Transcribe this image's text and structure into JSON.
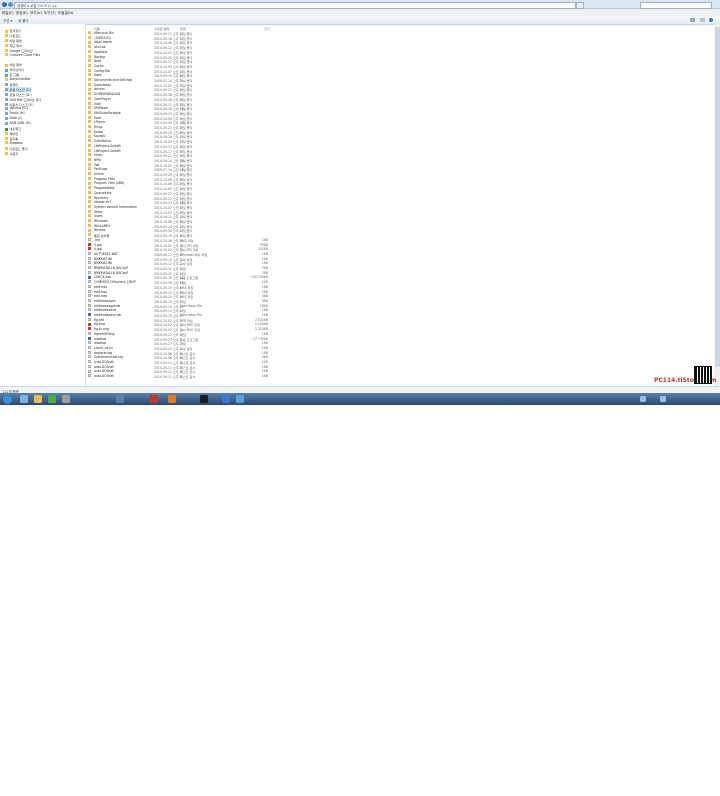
{
  "address": "컴퓨터 ▸ 로컬 디스크 (C:) ▸",
  "menu": [
    "파일(F)",
    "편집(E)",
    "보기(V)",
    "도구(T)",
    "도움말(H)"
  ],
  "toolbar": {
    "organize": "구성 ▾",
    "new_folder": "새 폴더"
  },
  "columns": {
    "name": "이름",
    "date": "수정한 날짜",
    "type": "유형",
    "size": "크기"
  },
  "nav": [
    {
      "label": "즐겨찾기",
      "icon": "star-icon"
    },
    {
      "label": "다운로드",
      "icon": "folder-icon"
    },
    {
      "label": "바탕 화면",
      "icon": "folder-icon"
    },
    {
      "label": "최근 위치",
      "icon": "folder-icon"
    },
    {
      "label": "Google 드라이브",
      "icon": "folder-icon"
    },
    {
      "label": "Creative Cloud Files",
      "icon": "folder-icon"
    },
    {
      "label": "",
      "icon": ""
    },
    {
      "label": "바탕 화면",
      "icon": "folder-icon"
    },
    {
      "label": "라이브러리",
      "icon": "library-icon"
    },
    {
      "label": "홈 그룹",
      "icon": "library-icon"
    },
    {
      "label": "Administrator",
      "icon": "folder-icon"
    },
    {
      "label": "컴퓨터",
      "icon": "drive-icon"
    },
    {
      "label": "로컬 디스크 (C:)",
      "icon": "drive-icon",
      "selected": true
    },
    {
      "label": "로컬 디스크 (D:)",
      "icon": "drive-icon"
    },
    {
      "label": "DVD RW 드라이브 (E:)",
      "icon": "drive-icon"
    },
    {
      "label": "이동식 디스크 (F:)",
      "icon": "drive-icon"
    },
    {
      "label": "Volume (G:)",
      "icon": "drive-icon"
    },
    {
      "label": "Public (H:)",
      "icon": "drive-icon"
    },
    {
      "label": "Data (I:)",
      "icon": "drive-icon"
    },
    {
      "label": "RAM DISK (R:)",
      "icon": "drive-icon"
    },
    {
      "label": "네트워크",
      "icon": "network-icon"
    },
    {
      "label": "제어판",
      "icon": "folder-icon"
    },
    {
      "label": "휴지통",
      "icon": "folder-icon"
    },
    {
      "label": "Dropbox",
      "icon": "folder-icon"
    },
    {
      "label": "다운로드 폴더",
      "icon": "folder-icon"
    },
    {
      "label": "사용자",
      "icon": "folder-icon"
    }
  ],
  "files": [
    {
      "name": "$Recycle.Bin",
      "date": "2014-09-11 오후 1:",
      "type": "파일 폴더",
      "size": "",
      "icon": "folder"
    },
    {
      "name": "_SMSDOCS",
      "date": "2014-09-16 오후 1:",
      "type": "파일 폴더",
      "size": "",
      "icon": "folder"
    },
    {
      "name": "AdwCleaner",
      "date": "2014-10-06 오후 4:",
      "type": "파일 폴더",
      "size": "",
      "icon": "folder"
    },
    {
      "name": "AhnLab",
      "date": "2014-09-12 오후 2:",
      "type": "파일 폴더",
      "size": "",
      "icon": "folder"
    },
    {
      "name": "AppData",
      "date": "2014-10-01 오전 9:",
      "type": "파일 폴더",
      "size": "",
      "icon": "folder"
    },
    {
      "name": "Backup",
      "date": "2014-09-20 오후 3:",
      "type": "파일 폴더",
      "size": "",
      "icon": "folder"
    },
    {
      "name": "Boot",
      "date": "2014-09-11 오후 1:",
      "type": "파일 폴더",
      "size": "",
      "icon": "folder"
    },
    {
      "name": "Cache",
      "date": "2014-10-05 오후 8:",
      "type": "파일 폴더",
      "size": "",
      "icon": "folder"
    },
    {
      "name": "Config.Msi",
      "date": "2014-10-07 오전 1:",
      "type": "파일 폴더",
      "size": "",
      "icon": "folder"
    },
    {
      "name": "Data",
      "date": "2014-09-15 오후 6:",
      "type": "파일 폴더",
      "size": "",
      "icon": "folder"
    },
    {
      "name": "Documents and Settings",
      "date": "2009-07-14 오후 2:",
      "type": "파일 폴더",
      "size": "",
      "icon": "folder"
    },
    {
      "name": "Downloads",
      "date": "2014-10-02 오후 7:",
      "type": "파일 폴더",
      "size": "",
      "icon": "folder"
    },
    {
      "name": "drivers",
      "date": "2014-09-11 오후 2:",
      "type": "파일 폴더",
      "size": "",
      "icon": "folder"
    },
    {
      "name": "GOMDOWNLOAD",
      "date": "2014-09-28 오후 5:",
      "type": "파일 폴더",
      "size": "",
      "icon": "folder"
    },
    {
      "name": "GomPlayer",
      "date": "2014-09-28 오후 5:",
      "type": "파일 폴더",
      "size": "",
      "icon": "folder"
    },
    {
      "name": "Intel",
      "date": "2014-09-11 오후 2:",
      "type": "파일 폴더",
      "size": "",
      "icon": "folder"
    },
    {
      "name": "KMPlayer",
      "date": "2014-09-18 오전 11:",
      "type": "파일 폴더",
      "size": "",
      "icon": "folder"
    },
    {
      "name": "KMSAutoPortable",
      "date": "2014-09-19 오후 9:",
      "type": "파일 폴더",
      "size": "",
      "icon": "folder"
    },
    {
      "name": "Kodi",
      "date": "2014-10-04 오후 3:",
      "type": "파일 폴더",
      "size": "",
      "icon": "folder"
    },
    {
      "name": "kPlayer",
      "date": "2014-09-30 오후 10:",
      "type": "파일 폴더",
      "size": "",
      "icon": "folder"
    },
    {
      "name": "Kings",
      "date": "2014-09-22 오후 4:",
      "type": "파일 폴더",
      "size": "",
      "icon": "folder"
    },
    {
      "name": "Korea",
      "date": "2014-09-25 오전 8:",
      "type": "파일 폴더",
      "size": "",
      "icon": "folder"
    },
    {
      "name": "Kovaos",
      "date": "2014-09-26 오후 2:",
      "type": "파일 폴더",
      "size": "",
      "icon": "folder"
    },
    {
      "name": "KuAnDalux",
      "date": "2014-10-03 오후 1:",
      "type": "파일 폴더",
      "size": "",
      "icon": "folder"
    },
    {
      "name": "LibProject.SolLeft",
      "date": "2014-09-17 오후 5:",
      "type": "파일 폴더",
      "size": "",
      "icon": "folder"
    },
    {
      "name": "LibProject.SolLeft",
      "date": "2014-09-17 오후 5:",
      "type": "파일 폴더",
      "size": "",
      "icon": "folder"
    },
    {
      "name": "Music",
      "date": "2014-09-21 오후 9:",
      "type": "파일 폴더",
      "size": "",
      "icon": "folder"
    },
    {
      "name": "NPKI",
      "date": "2014-09-14 오전 10:",
      "type": "파일 폴더",
      "size": "",
      "icon": "folder"
    },
    {
      "name": "Pak",
      "date": "2014-10-02 오후 6:",
      "type": "파일 폴더",
      "size": "",
      "icon": "folder"
    },
    {
      "name": "PerfLogs",
      "date": "2009-07-14 오전 11:",
      "type": "파일 폴더",
      "size": "",
      "icon": "folder"
    },
    {
      "name": "pirism",
      "date": "2014-09-29 오후 3:",
      "type": "파일 폴더",
      "size": "",
      "icon": "folder"
    },
    {
      "name": "Program Files",
      "date": "2014-10-06 오후 5:",
      "type": "파일 폴더",
      "size": "",
      "icon": "folder"
    },
    {
      "name": "Program Files (x86)",
      "date": "2014-10-06 오후 5:",
      "type": "파일 폴더",
      "size": "",
      "icon": "folder"
    },
    {
      "name": "ProgramData",
      "date": "2014-10-05 오전 2:",
      "type": "파일 폴더",
      "size": "",
      "icon": "folder"
    },
    {
      "name": "QuarantIne",
      "date": "2014-09-27 오후 7:",
      "type": "파일 폴더",
      "size": "",
      "icon": "folder"
    },
    {
      "name": "Recovery",
      "date": "2014-09-11 오후 1:",
      "type": "파일 폴더",
      "size": "",
      "icon": "folder"
    },
    {
      "name": "riboser-ch7",
      "date": "2014-09-23 오후 11:",
      "type": "파일 폴더",
      "size": "",
      "icon": "folder"
    },
    {
      "name": "System Volume Information",
      "date": "2014-10-07 오전 3:",
      "type": "파일 폴더",
      "size": "",
      "icon": "folder"
    },
    {
      "name": "Temp",
      "date": "2014-10-07 오전 2:",
      "type": "파일 폴더",
      "size": "",
      "icon": "folder"
    },
    {
      "name": "Users",
      "date": "2014-09-11 오후 1:",
      "type": "파일 폴더",
      "size": "",
      "icon": "folder"
    },
    {
      "name": "Windows",
      "date": "2014-10-06 오후 6:",
      "type": "파일 폴더",
      "size": "",
      "icon": "folder"
    },
    {
      "name": "WinLAMEx",
      "date": "2014-09-24 오후 2:",
      "type": "파일 폴더",
      "size": "",
      "icon": "folder"
    },
    {
      "name": "Wnmas",
      "date": "2014-09-30 오후 4:",
      "type": "파일 폴더",
      "size": "",
      "icon": "folder"
    },
    {
      "name": "통합 설치폴",
      "date": "2014-09-19 오후 8:",
      "type": "파일 폴더",
      "size": "",
      "icon": "folder"
    },
    {
      "name": ".rnd",
      "date": "2014-10-06 오후 1:",
      "type": "RND 파일",
      "size": "1KB",
      "icon": "file"
    },
    {
      "name": "3.jpg",
      "date": "2014-10-02 오후 3:",
      "type": "알씨 JPG 파일",
      "size": "95KB",
      "icon": "red"
    },
    {
      "name": "4.jpg",
      "date": "2014-10-02 오후 3:",
      "type": "알씨 JPG 파일",
      "size": "102KB",
      "icon": "red"
    },
    {
      "name": "AUTOEXEC.BAT",
      "date": "2009-06-11 오전 6:",
      "type": "Windows 배치 파일",
      "size": "1KB",
      "icon": "file"
    },
    {
      "name": "BMKMAT.INI",
      "date": "2014-09-12 오후 2:",
      "type": "구성 설정",
      "size": "1KB",
      "icon": "file"
    },
    {
      "name": "BMKMAT.INI",
      "date": "2014-09-12 오후 2:",
      "type": "구성 설정",
      "size": "1KB",
      "icon": "file"
    },
    {
      "name": "BMKMATALLB_BACkuP",
      "date": "2014-09-12 오후 2:",
      "type": "파일",
      "size": "2KB",
      "icon": "file"
    },
    {
      "name": "BMKMATALLB_BACkuP",
      "date": "2014-09-12 오후 2:",
      "type": "파일",
      "size": "2KB",
      "icon": "file"
    },
    {
      "name": "CHECK.exe",
      "date": "2014-09-18 오전 11:",
      "type": "응용 프로그램",
      "size": "100,700KB",
      "icon": "app"
    },
    {
      "name": "COMMON_CMscheck_DRVP",
      "date": "2014-09-18 오전 11:",
      "type": "파일",
      "size": "1KB",
      "icon": "file"
    },
    {
      "name": "edit.mss",
      "date": "2014-09-15 오후 4:",
      "type": "MSS 파일",
      "size": "1KB",
      "icon": "file"
    },
    {
      "name": "edit.mss",
      "date": "2014-09-15 오후 4:",
      "type": "MSS 파일",
      "size": "1KB",
      "icon": "file"
    },
    {
      "name": "edit.mss",
      "date": "2014-09-15 오후 4:",
      "type": "MSS 파일",
      "size": "3KB",
      "icon": "file"
    },
    {
      "name": "editmessages",
      "date": "2014-09-15 오후 4:",
      "type": "파일",
      "size": "3KB",
      "icon": "file"
    },
    {
      "name": "editmessages.db",
      "date": "2014-09-15 오후 4:",
      "type": "Data Base File",
      "size": "18KB",
      "icon": "file"
    },
    {
      "name": "editmodesave",
      "date": "2014-09-15 오후 4:",
      "type": "파일",
      "size": "1KB",
      "icon": "file"
    },
    {
      "name": "editmodesave.db",
      "date": "2014-09-15 오후 4:",
      "type": "Data Base File",
      "size": "2KB",
      "icon": "app"
    },
    {
      "name": "fig.pfd",
      "date": "2014-10-02 오후 3:",
      "type": "PFD 파일",
      "size": "2,532KB",
      "icon": "file"
    },
    {
      "name": "fig.png",
      "date": "2014-10-02 오후 3:",
      "type": "알씨 PNG 파일",
      "size": "2,100KB",
      "icon": "red"
    },
    {
      "name": "fig.th.png",
      "date": "2014-10-02 오후 3:",
      "type": "알씨 PNG 파일",
      "size": "1,214KB",
      "icon": "red"
    },
    {
      "name": "frgmentFiling",
      "date": "2014-09-21 오후 9:",
      "type": "파일",
      "size": "1KB",
      "icon": "file"
    },
    {
      "name": "lolsetup",
      "date": "2014-09-27 오후 7:",
      "type": "응용 프로그램",
      "size": "17,730KB",
      "icon": "app"
    },
    {
      "name": "lolsetup",
      "date": "2014-09-27 오후 7:",
      "type": "파일",
      "size": "1KB",
      "icon": "file"
    },
    {
      "name": "check_cd.ini",
      "date": "2014-09-20 오후 5:",
      "type": "구성 설정",
      "size": "1KB",
      "icon": "file"
    },
    {
      "name": "explorer.log",
      "date": "2014-10-06 오후 3:",
      "type": "텍스트 문서",
      "size": "1KB",
      "icon": "file"
    },
    {
      "name": "Systemchecker.log",
      "date": "2014-10-06 오후 3:",
      "type": "텍스트 문서",
      "size": "4KB",
      "icon": "file"
    },
    {
      "name": "auto.DOSnet",
      "date": "2014-09-11 오후 2:",
      "type": "텍스트 문서",
      "size": "1KB",
      "icon": "file"
    },
    {
      "name": "auto.DOSnet",
      "date": "2014-09-11 오후 2:",
      "type": "텍스트 문서",
      "size": "1KB",
      "icon": "file"
    },
    {
      "name": "auto.DOSnet",
      "date": "2014-09-11 오후 2:",
      "type": "텍스트 문서",
      "size": "1KB",
      "icon": "file"
    },
    {
      "name": "auto.DOSnet",
      "date": "2014-09-11 오후 2:",
      "type": "텍스트 문서",
      "size": "1KB",
      "icon": "file"
    }
  ],
  "status": "112개 항목",
  "watermark": "PC114.tiStory.com",
  "clock": {
    "time": "오후 3:29",
    "date": "2014-10-07"
  },
  "colors": {
    "folder": "#e8c05a",
    "selection": "#cce4f7",
    "taskbar": "#2a4a73",
    "watermark": "#c0392b"
  }
}
